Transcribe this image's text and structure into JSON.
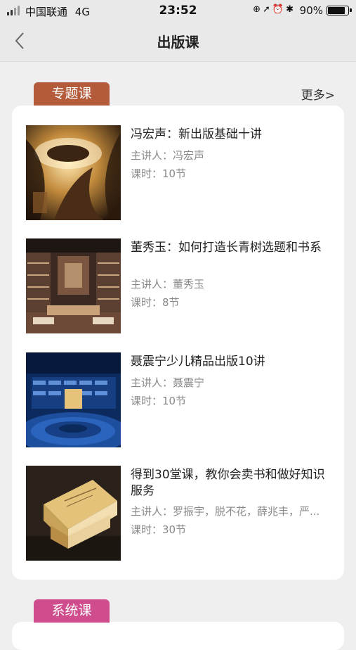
{
  "status_bar": {
    "carrier": "中国联通",
    "network": "4G",
    "time": "23:52",
    "battery_percent": "90%",
    "battery_level": 0.9,
    "icons": [
      "orientation-lock-icon",
      "location-icon",
      "alarm-icon",
      "bluetooth-icon"
    ]
  },
  "nav": {
    "title": "出版课",
    "back_icon": "chevron-left-icon"
  },
  "section_topic": {
    "label": "专题课",
    "more": "更多>",
    "color": "#b45b3c"
  },
  "courses": [
    {
      "title": "冯宏声：新出版基础十讲",
      "lecturer": "主讲人：冯宏声",
      "lessons": "课时：10节"
    },
    {
      "title": "董秀玉：如何打造长青树选题和书系",
      "lecturer": "主讲人：董秀玉",
      "lessons": "课时：8节"
    },
    {
      "title": "聂震宁少儿精品出版10讲",
      "lecturer": "主讲人：聂震宁",
      "lessons": "课时：10节"
    },
    {
      "title": " 得到30堂课，教你会卖书和做好知识服务",
      "lecturer": "主讲人：罗振宇，脱不花，薛兆丰，严...",
      "lessons": "课时：30节"
    }
  ],
  "section_system": {
    "label": "系统课",
    "color": "#cf4d8c"
  }
}
